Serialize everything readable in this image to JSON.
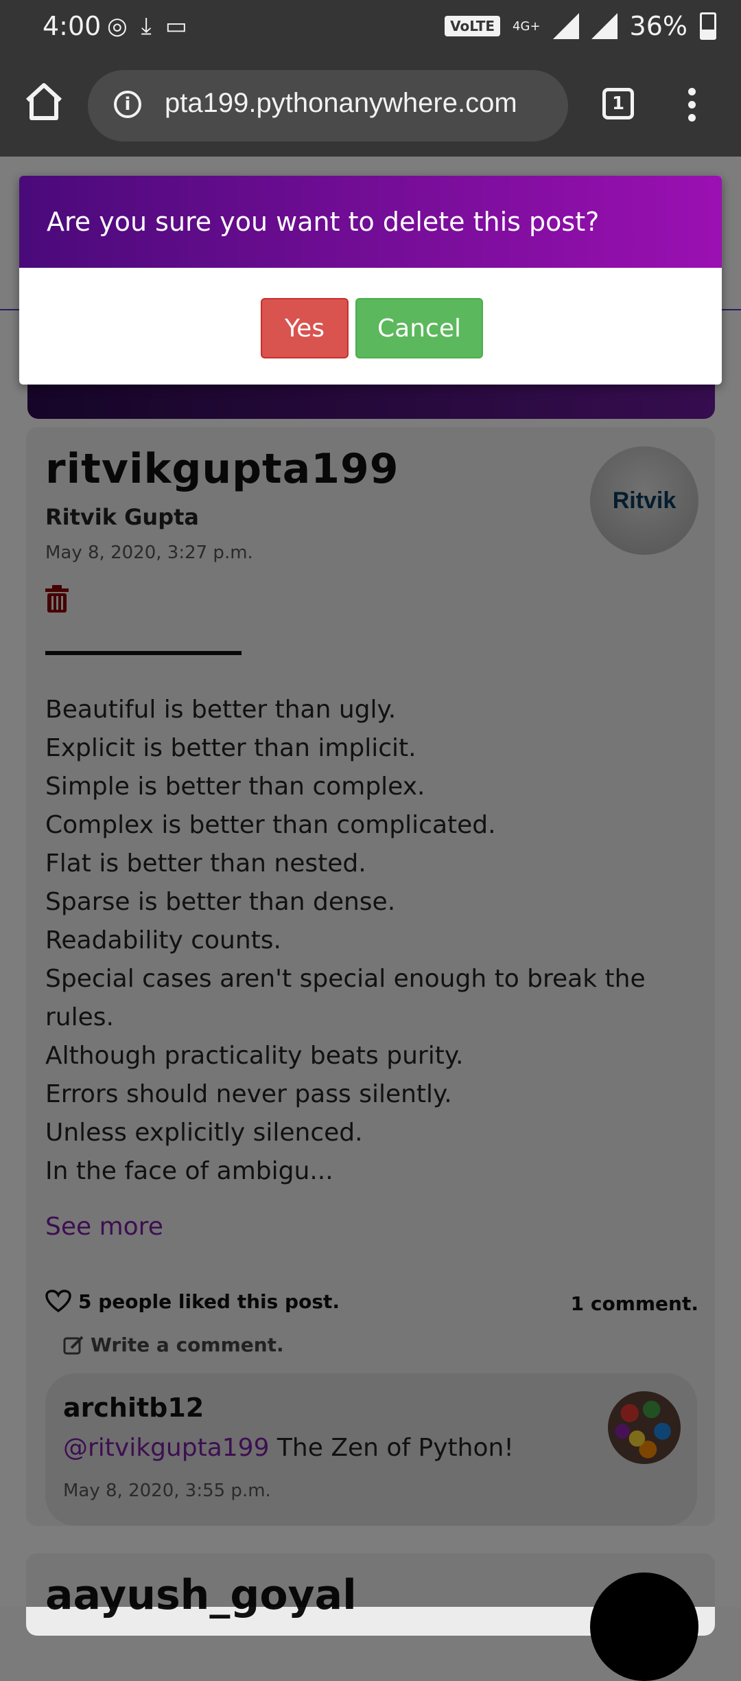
{
  "status_bar": {
    "time": "4:00",
    "network_badge": "VoLTE",
    "network_type": "4G+",
    "battery": "36%"
  },
  "browser": {
    "url": "pta199.pythonanywhere.com",
    "tab_count": "1"
  },
  "dialog": {
    "title": "Are you sure you want to delete this post?",
    "yes_label": "Yes",
    "cancel_label": "Cancel",
    "colors": {
      "header_start": "#4a0a7a",
      "header_end": "#9b10b2",
      "yes": "#d9534f",
      "cancel": "#5cb85c"
    }
  },
  "post": {
    "username": "ritvikgupta199",
    "full_name": "Ritvik Gupta",
    "date": "May 8, 2020, 3:27 p.m.",
    "avatar_text": "Ritvik",
    "body_lines": [
      "Beautiful is better than ugly.",
      "Explicit is better than implicit.",
      "Simple is better than complex.",
      "Complex is better than complicated.",
      "Flat is better than nested.",
      "Sparse is better than dense.",
      "Readability counts.",
      "Special cases aren't special enough to break the",
      "rules.",
      "Although practicality beats purity.",
      "Errors should never pass silently.",
      "Unless explicitly silenced.",
      "In the face of ambigu..."
    ],
    "see_more": "See more",
    "likes_text": "5 people liked this post.",
    "comments_count": "1 comment.",
    "write_comment": "Write a comment.",
    "comment": {
      "user": "architb12",
      "mention": "@ritvikgupta199",
      "text": " The Zen of Python!",
      "date": "May 8, 2020, 3:55 p.m."
    }
  },
  "next_post": {
    "username": "aayush_goyal"
  }
}
